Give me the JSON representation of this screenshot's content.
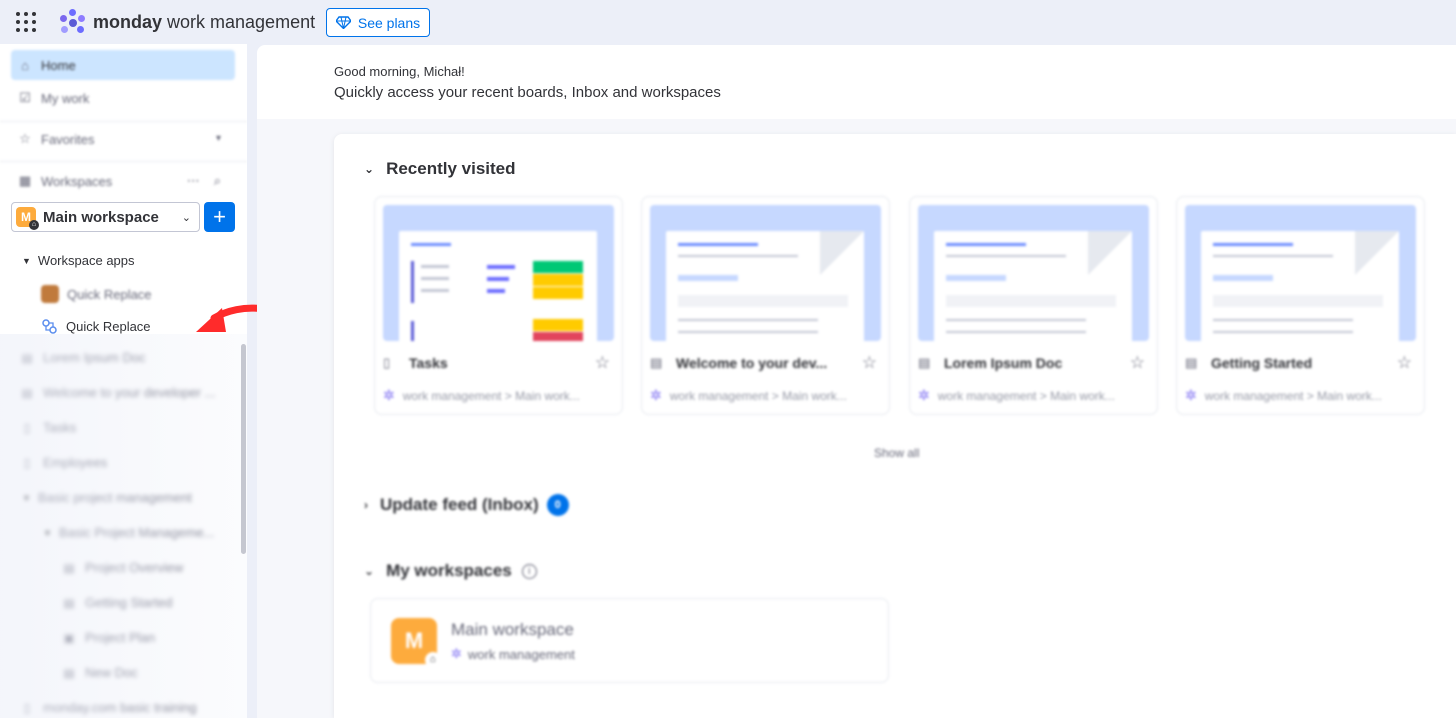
{
  "topbar": {
    "brand_bold": "monday",
    "brand_rest": " work management",
    "see_plans_label": "See plans",
    "accent_color": "#0073ea"
  },
  "sidebar": {
    "home_label": "Home",
    "mywork_label": "My work",
    "favorites_label": "Favorites",
    "workspaces_label": "Workspaces",
    "workspace_badge": "M",
    "workspace_name": "Main workspace",
    "add_label": "+",
    "workspace_apps_label": "Workspace apps",
    "apps": [
      "Quick Replace",
      "Quick Replace"
    ],
    "items": [
      {
        "icon": "doc-icon",
        "label": "Lorem Ipsum Doc"
      },
      {
        "icon": "doc-icon",
        "label": "Welcome to your developer ..."
      },
      {
        "icon": "board-icon",
        "label": "Tasks"
      },
      {
        "icon": "board-icon",
        "label": "Employees"
      },
      {
        "icon": "folder-caret",
        "label": "Basic project management"
      },
      {
        "icon": "folder-caret",
        "label": "Basic Project Manageme..."
      },
      {
        "icon": "doc-icon",
        "label": "Project Overview"
      },
      {
        "icon": "doc-icon",
        "label": "Getting Started"
      },
      {
        "icon": "gantt-icon",
        "label": "Project Plan"
      },
      {
        "icon": "doc-icon",
        "label": "New Doc"
      },
      {
        "icon": "board-icon",
        "label": "monday.com basic training"
      }
    ]
  },
  "main": {
    "greeting": "Good morning, Michał!",
    "subtitle": "Quickly access your recent boards, Inbox and workspaces",
    "recently_visited_title": "Recently visited",
    "cards": [
      {
        "icon": "board-icon",
        "title": "Tasks",
        "path": "work management > Main work..."
      },
      {
        "icon": "doc-icon",
        "title": "Welcome to your dev...",
        "path": "work management > Main work..."
      },
      {
        "icon": "doc-icon",
        "title": "Lorem Ipsum Doc",
        "path": "work management > Main work..."
      },
      {
        "icon": "doc-icon",
        "title": "Getting Started",
        "path": "work management > Main work..."
      }
    ],
    "show_all_label": "Show all",
    "update_feed_title": "Update feed (Inbox)",
    "inbox_count": "0",
    "my_workspaces_title": "My workspaces",
    "workspace_card": {
      "badge": "M",
      "name": "Main workspace",
      "sub": "work management"
    }
  },
  "colors": {
    "workspace_orange": "#fdab3d",
    "active_nav": "#cce5ff",
    "arrow_red": "#ff2b2b"
  }
}
